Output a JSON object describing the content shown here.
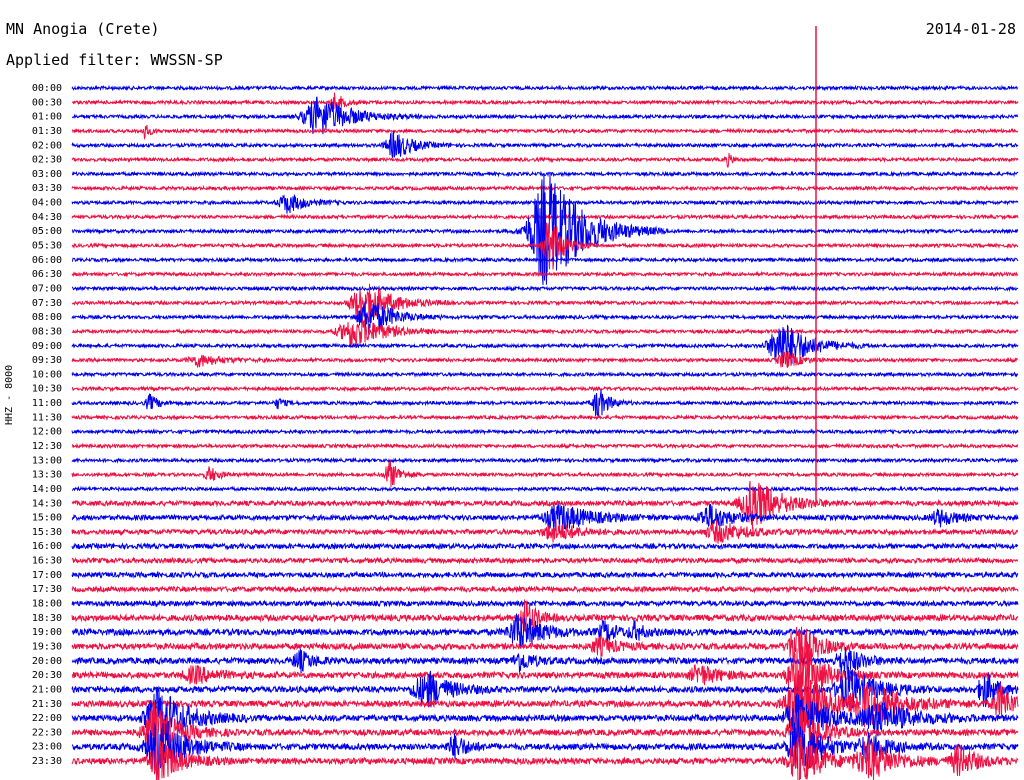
{
  "header": {
    "title": "MN Anogia (Crete)",
    "filter": "Applied filter: WWSSN-SP",
    "date": "2014-01-28"
  },
  "station_label": "HHZ - 8000",
  "colors": {
    "even": "#0000ee",
    "odd": "#ee1144"
  },
  "trace_labels": [
    "00:00",
    "00:30",
    "01:00",
    "01:30",
    "02:00",
    "02:30",
    "03:00",
    "03:30",
    "04:00",
    "04:30",
    "05:00",
    "05:30",
    "06:00",
    "06:30",
    "07:00",
    "07:30",
    "08:00",
    "08:30",
    "09:00",
    "09:30",
    "10:00",
    "10:30",
    "11:00",
    "11:30",
    "12:00",
    "12:30",
    "13:00",
    "13:30",
    "14:00",
    "14:30",
    "15:00",
    "15:30",
    "16:00",
    "16:30",
    "17:00",
    "17:30",
    "18:00",
    "18:30",
    "19:00",
    "19:30",
    "20:00",
    "20:30",
    "21:00",
    "21:30",
    "22:00",
    "22:30",
    "23:00",
    "23:30"
  ]
}
